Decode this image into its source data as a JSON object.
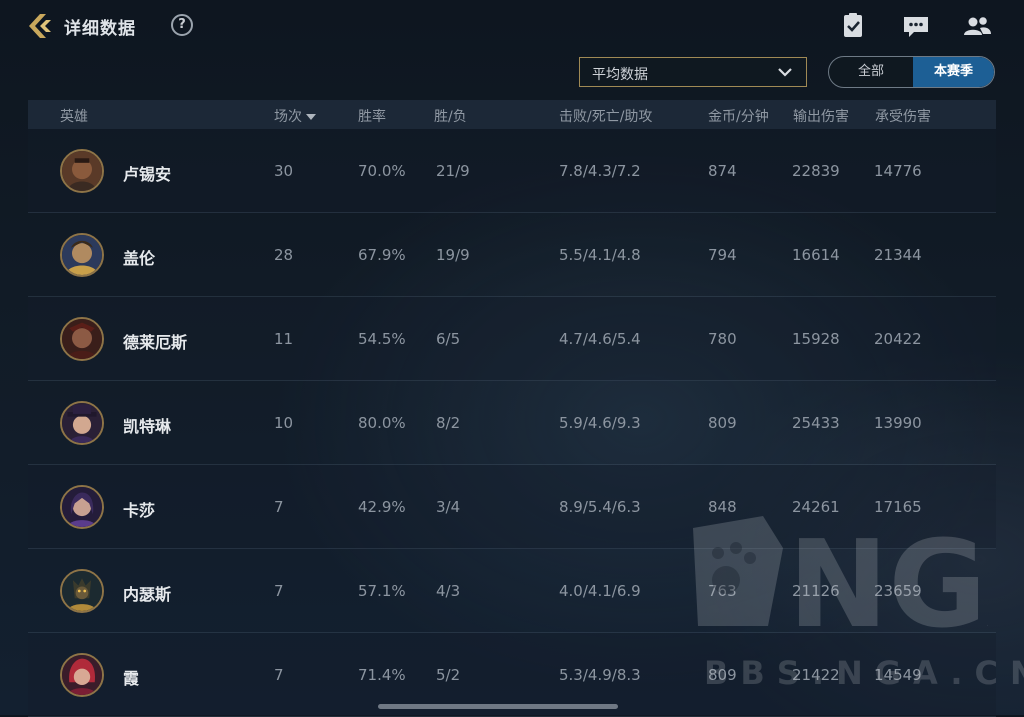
{
  "header": {
    "title": "详细数据",
    "help_label": "?",
    "icons": [
      "back-icon",
      "help-icon",
      "checklist-icon",
      "chat-icon",
      "friends-icon"
    ]
  },
  "filter": {
    "dropdown_value": "平均数据",
    "segment_all": "全部",
    "segment_season": "本赛季",
    "segment_selected": "本赛季"
  },
  "table": {
    "columns": {
      "hero": "英雄",
      "games": "场次",
      "winrate": "胜率",
      "wl": "胜/负",
      "kda": "击败/死亡/助攻",
      "gold": "金币/分钟",
      "dmg_out": "输出伤害",
      "dmg_taken": "承受伤害"
    },
    "sort_column": "场次",
    "rows": [
      {
        "hero": "卢锡安",
        "games": "30",
        "winrate": "70.0%",
        "wl": "21/9",
        "kda": "7.8/4.3/7.2",
        "gold": "874",
        "dmg_out": "22839",
        "dmg_taken": "14776"
      },
      {
        "hero": "盖伦",
        "games": "28",
        "winrate": "67.9%",
        "wl": "19/9",
        "kda": "5.5/4.1/4.8",
        "gold": "794",
        "dmg_out": "16614",
        "dmg_taken": "21344"
      },
      {
        "hero": "德莱厄斯",
        "games": "11",
        "winrate": "54.5%",
        "wl": "6/5",
        "kda": "4.7/4.6/5.4",
        "gold": "780",
        "dmg_out": "15928",
        "dmg_taken": "20422"
      },
      {
        "hero": "凯特琳",
        "games": "10",
        "winrate": "80.0%",
        "wl": "8/2",
        "kda": "5.9/4.6/9.3",
        "gold": "809",
        "dmg_out": "25433",
        "dmg_taken": "13990"
      },
      {
        "hero": "卡莎",
        "games": "7",
        "winrate": "42.9%",
        "wl": "3/4",
        "kda": "8.9/5.4/6.3",
        "gold": "848",
        "dmg_out": "24261",
        "dmg_taken": "17165"
      },
      {
        "hero": "内瑟斯",
        "games": "7",
        "winrate": "57.1%",
        "wl": "4/3",
        "kda": "4.0/4.1/6.9",
        "gold": "763",
        "dmg_out": "21126",
        "dmg_taken": "23659"
      },
      {
        "hero": "霞",
        "games": "7",
        "winrate": "71.4%",
        "wl": "5/2",
        "kda": "5.3/4.9/8.3",
        "gold": "809",
        "dmg_out": "21422",
        "dmg_taken": "14549"
      }
    ]
  },
  "watermark": {
    "logo_text": "NGA",
    "site": "BBS.NGA.CN"
  },
  "colors": {
    "accent_gold": "#a08a55",
    "segment_active": "#1d5f95",
    "background": "#111b26"
  }
}
